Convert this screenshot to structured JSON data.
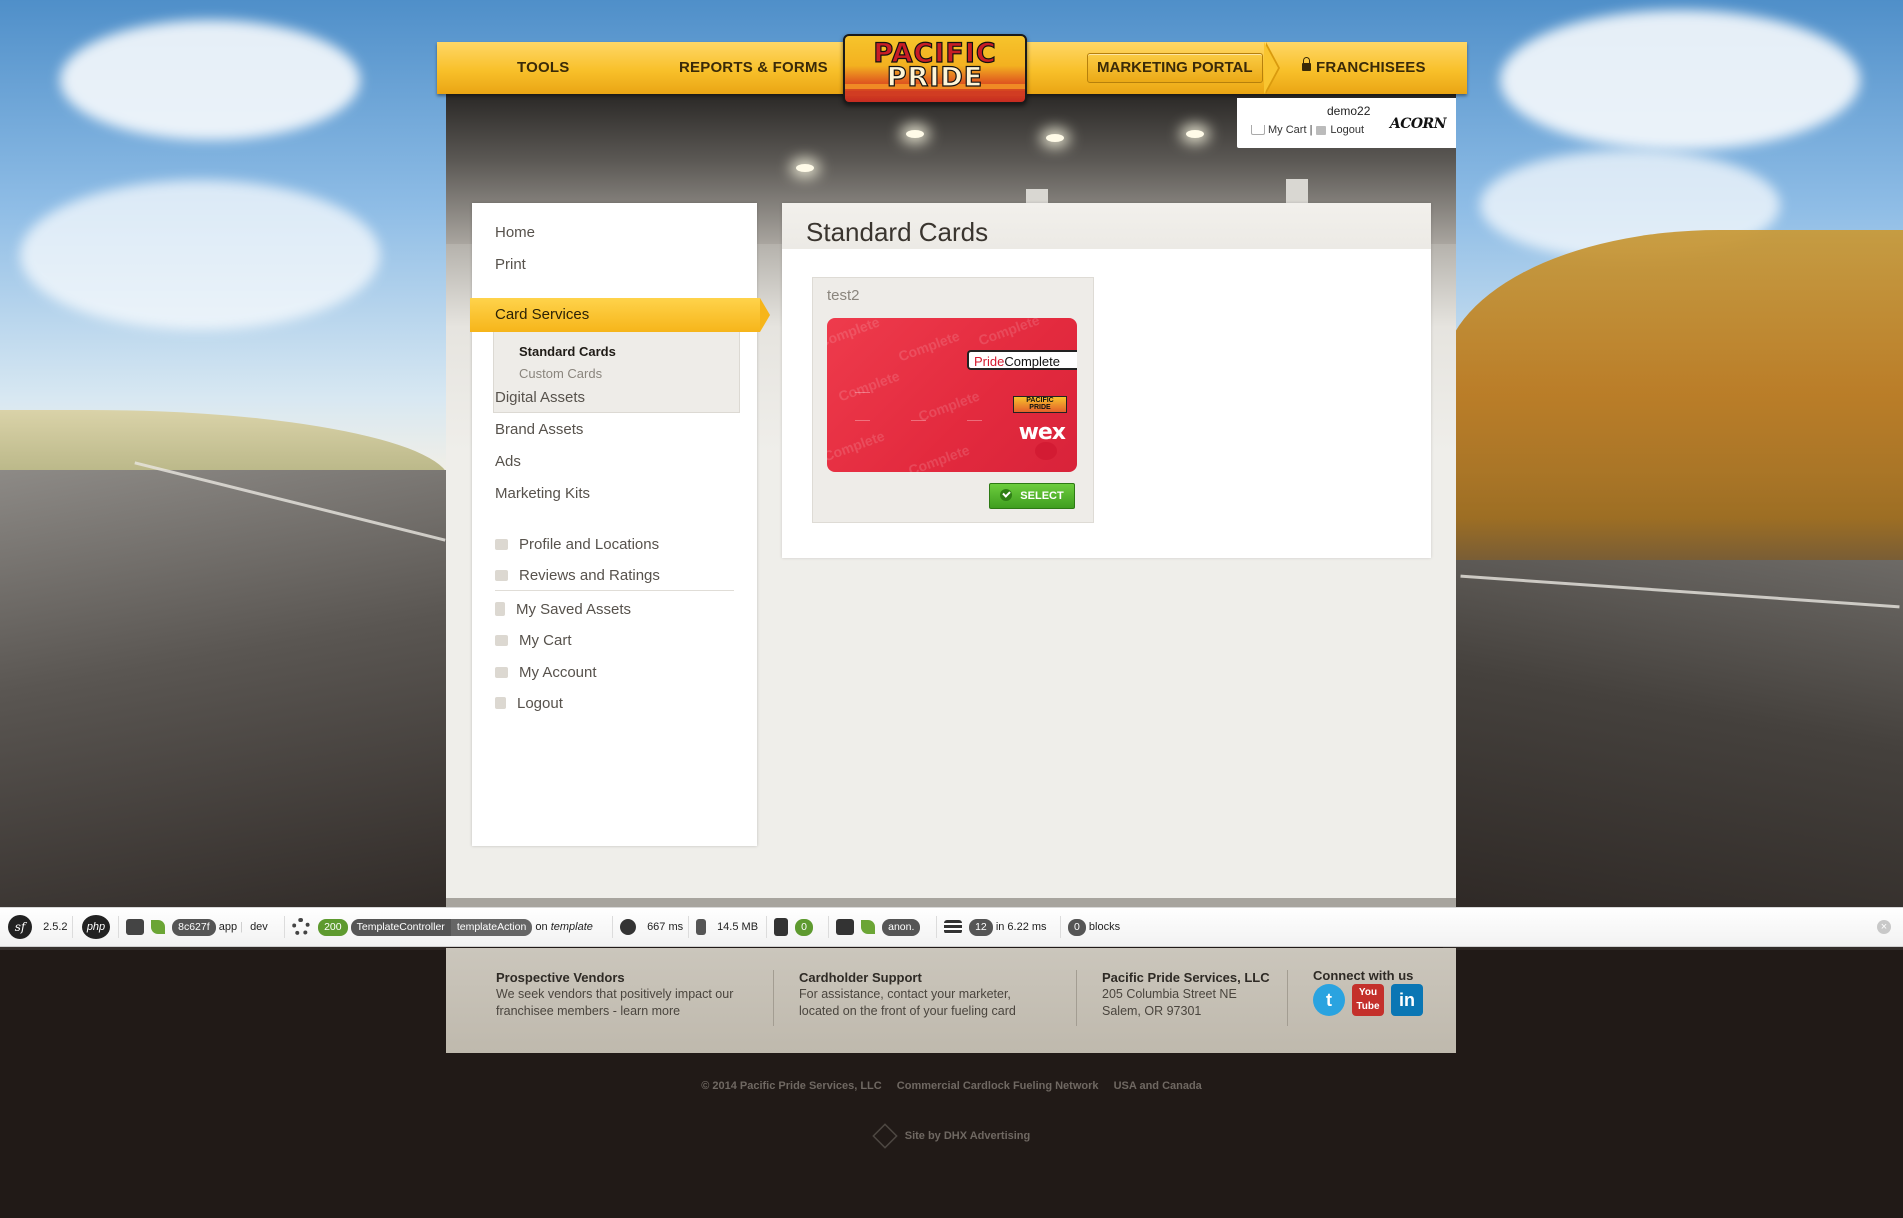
{
  "nav": {
    "tools": "TOOLS",
    "reports_forms": "REPORTS & FORMS",
    "logo_line1": "PACIFIC",
    "logo_line2": "PRIDE",
    "marketing_portal": "MARKETING PORTAL",
    "franchisees": "FRANCHISEES"
  },
  "user": {
    "username": "demo22",
    "my_cart": "My Cart",
    "separator": "|",
    "logout": "Logout",
    "partner_logo": "ACORN"
  },
  "sidebar": {
    "items": [
      "Home",
      "Print",
      "Card Services",
      "Digital Assets",
      "Brand Assets",
      "Ads",
      "Marketing Kits"
    ],
    "active": "Card Services",
    "submenu": [
      "Standard Cards",
      "Custom Cards"
    ],
    "account_items": [
      {
        "label": "Profile and Locations",
        "icon": "building-icon"
      },
      {
        "label": "Reviews and Ratings",
        "icon": "comment-icon"
      },
      {
        "label": "My Saved Assets",
        "icon": "document-icon"
      },
      {
        "label": "My Cart",
        "icon": "cart-icon"
      },
      {
        "label": "My Account",
        "icon": "account-icon"
      },
      {
        "label": "Logout",
        "icon": "lock-icon"
      }
    ]
  },
  "main": {
    "title": "Standard Cards",
    "card": {
      "name": "test2",
      "brand_pride": "Pride",
      "brand_complete": "Complete",
      "wex": "wex",
      "watermark": "Complete",
      "select_label": "SELECT"
    }
  },
  "footer": {
    "col1": {
      "heading": "Prospective Vendors",
      "line1": "We seek vendors that positively impact our",
      "line2": "franchisee members - learn more"
    },
    "col2": {
      "heading": "Cardholder Support",
      "line1": "For assistance, contact your marketer,",
      "line2": "located on the front of your fueling card"
    },
    "col3": {
      "heading": "Pacific Pride Services, LLC",
      "line1": "205 Columbia Street NE",
      "line2": "Salem, OR 97301"
    },
    "connect": "Connect with us",
    "social": [
      "twitter-icon",
      "youtube-icon",
      "linkedin-icon"
    ],
    "copyright": "© 2014 Pacific Pride Services, LLC",
    "network": "Commercial Cardlock Fueling Network",
    "region": "USA and Canada",
    "siteby": "Site by DHX Advertising"
  },
  "debug_toolbar": {
    "sf_version": "2.5.2",
    "php_label": "php",
    "token": "8c627f",
    "app": "app",
    "env": "dev",
    "status": "200",
    "controller": "TemplateController",
    "action": "templateAction",
    "on_label": "on",
    "route": "template",
    "time": "667 ms",
    "memory": "14.5 MB",
    "form_count": "0",
    "user": "anon.",
    "queries": "12",
    "query_time": "in 6.22 ms",
    "blocks_count": "0",
    "blocks_label": "blocks",
    "close": "×"
  },
  "colors": {
    "nav_yellow": "#f8c02a",
    "card_red": "#e32a3e",
    "select_green": "#4fae28",
    "text_dark": "#3a352f"
  }
}
